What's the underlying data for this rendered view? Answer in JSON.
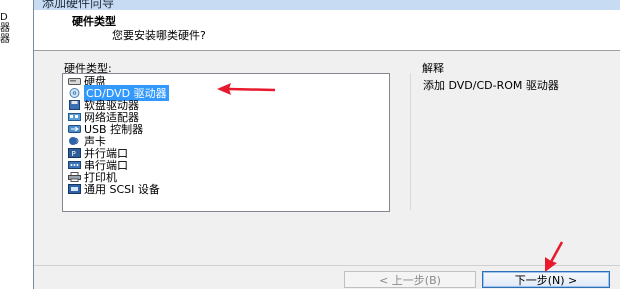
{
  "left_fragments": [
    "D",
    "器",
    "器"
  ],
  "window": {
    "title": "添加硬件向导"
  },
  "header": {
    "title": "硬件类型",
    "subtitle": "您要安装哪类硬件?"
  },
  "hardware_list": {
    "label": "硬件类型:",
    "items": [
      {
        "label": "硬盘",
        "icon": "hard-disk-icon",
        "selected": false
      },
      {
        "label": "CD/DVD 驱动器",
        "icon": "cd-dvd-icon",
        "selected": true
      },
      {
        "label": "软盘驱动器",
        "icon": "floppy-icon",
        "selected": false
      },
      {
        "label": "网络适配器",
        "icon": "network-adapter-icon",
        "selected": false
      },
      {
        "label": "USB 控制器",
        "icon": "usb-icon",
        "selected": false
      },
      {
        "label": "声卡",
        "icon": "sound-card-icon",
        "selected": false
      },
      {
        "label": "并行端口",
        "icon": "parallel-port-icon",
        "selected": false
      },
      {
        "label": "串行端口",
        "icon": "serial-port-icon",
        "selected": false
      },
      {
        "label": "打印机",
        "icon": "printer-icon",
        "selected": false
      },
      {
        "label": "通用 SCSI 设备",
        "icon": "scsi-icon",
        "selected": false
      }
    ]
  },
  "explanation": {
    "label": "解释",
    "text": "添加 DVD/CD-ROM 驱动器"
  },
  "buttons": {
    "back": "< 上一步(B)",
    "next": "下一步(N) >"
  },
  "colors": {
    "selection": "#3399ff",
    "annotation_arrow": "#e8192c"
  }
}
